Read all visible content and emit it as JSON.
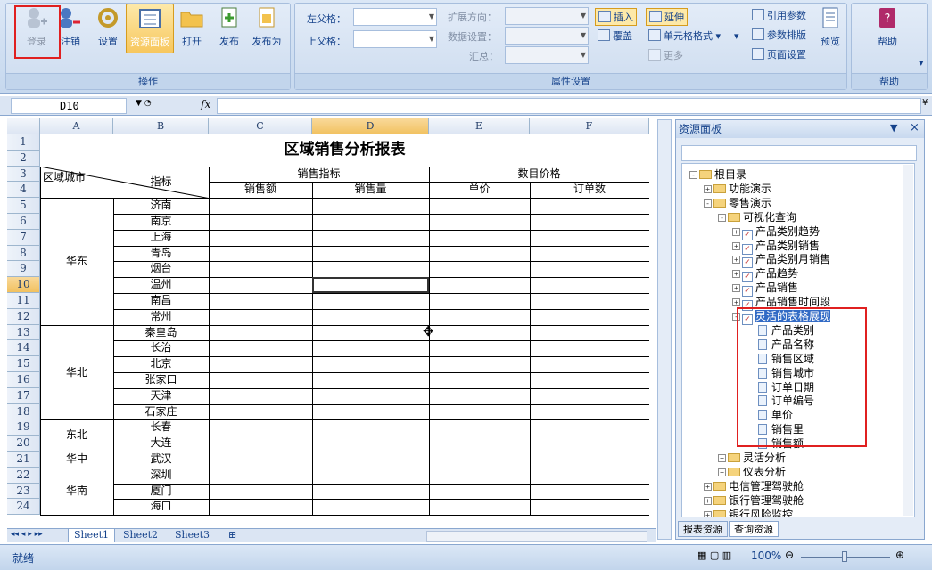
{
  "ribbon": {
    "buttons": [
      "登录",
      "注销",
      "设置",
      "资源面板",
      "打开",
      "发布",
      "发布为"
    ],
    "group_ops": "操作",
    "group_props": "属性设置",
    "group_help": "帮助",
    "left_parent": "左父格：",
    "top_parent": "上父格：",
    "expand_dir": "扩展方向：",
    "data_setting": "数据设置：",
    "summary": "汇总：",
    "insert": "插入",
    "cover": "覆盖",
    "extend": "延伸",
    "cell_format": "单元格格式",
    "more": "更多",
    "ref_params": "引用参数",
    "param_layout": "参数排版",
    "page_setup": "页面设置",
    "preview": "预览",
    "help": "帮助"
  },
  "formula": {
    "cell_ref": "D10",
    "fx": "fx"
  },
  "sheet": {
    "columns": [
      "A",
      "B",
      "C",
      "D",
      "E",
      "F"
    ],
    "rows": [
      "1",
      "2",
      "3",
      "4",
      "5",
      "6",
      "7",
      "8",
      "9",
      "10",
      "11",
      "12",
      "13",
      "14",
      "15",
      "16",
      "17",
      "18",
      "19",
      "20",
      "21",
      "22",
      "23",
      "24"
    ],
    "title": "区域销售分析报表",
    "hdr_region": "区域城市",
    "hdr_index": "指标",
    "hdr_sales": "销售指标",
    "hdr_price_group": "数目价格",
    "hdr_amount": "销售额",
    "hdr_qty": "销售量",
    "hdr_unit": "单价",
    "hdr_orders": "订单数",
    "regions": [
      "华东",
      "华北",
      "东北",
      "华中",
      "华南"
    ],
    "cities": [
      "济南",
      "南京",
      "上海",
      "青岛",
      "烟台",
      "温州",
      "南昌",
      "常州",
      "秦皇岛",
      "长治",
      "北京",
      "张家口",
      "天津",
      "石家庄",
      "长春",
      "大连",
      "武汉",
      "深圳",
      "厦门",
      "海口"
    ],
    "tabs": [
      "Sheet1",
      "Sheet2",
      "Sheet3"
    ]
  },
  "status": {
    "ready": "就绪",
    "zoom": "100%"
  },
  "panel": {
    "title": "资源面板",
    "tree": [
      {
        "t": "根目录",
        "l": 0,
        "k": "folder",
        "pm": "-"
      },
      {
        "t": "功能演示",
        "l": 1,
        "k": "folder",
        "pm": "+"
      },
      {
        "t": "零售演示",
        "l": 1,
        "k": "folder",
        "pm": "-"
      },
      {
        "t": "可视化查询",
        "l": 2,
        "k": "folder",
        "pm": "-"
      },
      {
        "t": "产品类别趋势",
        "l": 3,
        "k": "chk",
        "pm": "+"
      },
      {
        "t": "产品类别销售",
        "l": 3,
        "k": "chk",
        "pm": "+"
      },
      {
        "t": "产品类别月销售",
        "l": 3,
        "k": "chk",
        "pm": "+"
      },
      {
        "t": "产品趋势",
        "l": 3,
        "k": "chk",
        "pm": "+"
      },
      {
        "t": "产品销售",
        "l": 3,
        "k": "chk",
        "pm": "+"
      },
      {
        "t": "产品销售时间段",
        "l": 3,
        "k": "chk",
        "pm": "+"
      },
      {
        "t": "灵活的表格展现",
        "l": 3,
        "k": "chk",
        "pm": "-",
        "sel": true
      },
      {
        "t": "产品类别",
        "l": 4,
        "k": "doc"
      },
      {
        "t": "产品名称",
        "l": 4,
        "k": "doc"
      },
      {
        "t": "销售区域",
        "l": 4,
        "k": "doc"
      },
      {
        "t": "销售城市",
        "l": 4,
        "k": "doc"
      },
      {
        "t": "订单日期",
        "l": 4,
        "k": "doc"
      },
      {
        "t": "订单编号",
        "l": 4,
        "k": "doc"
      },
      {
        "t": "单价",
        "l": 4,
        "k": "doc"
      },
      {
        "t": "销售里",
        "l": 4,
        "k": "doc"
      },
      {
        "t": "销售额",
        "l": 4,
        "k": "doc"
      },
      {
        "t": "灵活分析",
        "l": 2,
        "k": "folder",
        "pm": "+"
      },
      {
        "t": "仪表分析",
        "l": 2,
        "k": "folder",
        "pm": "+"
      },
      {
        "t": "电信管理驾驶舱",
        "l": 1,
        "k": "folder",
        "pm": "+"
      },
      {
        "t": "银行管理驾驶舱",
        "l": 1,
        "k": "folder",
        "pm": "+"
      },
      {
        "t": "银行风险监控",
        "l": 1,
        "k": "folder",
        "pm": "+"
      }
    ],
    "tab_report": "报表资源",
    "tab_query": "查询资源"
  }
}
